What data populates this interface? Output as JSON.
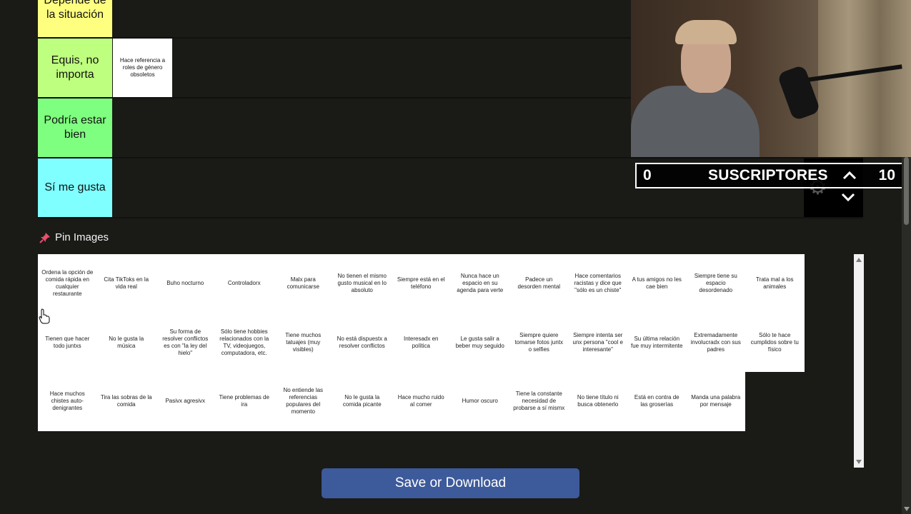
{
  "tiers": [
    {
      "label": "Depende de la situación",
      "color": "#ffff7f",
      "items": []
    },
    {
      "label": "Equis, no importa",
      "color": "#bfff7f",
      "items": [
        "Hace referencia a roles de género obsoletos"
      ]
    },
    {
      "label": "Podría estar bien",
      "color": "#7fff7f",
      "items": []
    },
    {
      "label": "Sí me gusta",
      "color": "#7fffff",
      "items": []
    }
  ],
  "overlay": {
    "current": "0",
    "label": "SUSCRIPTORES",
    "goal": "10"
  },
  "pin_section": {
    "title": "Pin Images",
    "icon": "pushpin-icon",
    "icon_color": "#e5506a"
  },
  "pins": [
    [
      "Ordena la opción de comida rápida en cualquier restaurante",
      "Cita TikToks en la vida real",
      "Buho nocturno",
      "Controladorx",
      "Malx para comunicarse",
      "No tienen el mismo gusto musical en lo absoluto",
      "Siempre está en el teléfono",
      "Nunca hace un espacio en su agenda para verte",
      "Padece un desorden mental",
      "Hace comentarios racistas y dice que \"sólo es un chiste\"",
      "A tus amigos no les cae bien",
      "Siempre tiene su espacio desordenado",
      "Trata mal a los animales"
    ],
    [
      "Tienen que hacer todo juntxs",
      "No le gusta la música",
      "Su forma de resolver conflictos es con \"la ley del hielo\"",
      "Sólo tiene hobbies relacionados con la TV, videojuegos, computadora, etc.",
      "Tiene muchos tatuajes (muy visibles)",
      "No está dispuestx a resolver conflictos",
      "Interesadx en política",
      "Le gusta salir a beber muy seguido",
      "Siempre quiere tomarse fotos juntx o selfies",
      "Siempre intenta ser unx persona \"cool e interesante\"",
      "Su última relación fue muy intermitente",
      "Extremadamente involucradx con sus padres",
      "Sólo te hace cumplidos sobre tu físico"
    ],
    [
      "Hace muchos chistes auto-denigrantes",
      "Tira las sobras de la comida",
      "Pasivx agresivx",
      "Tiene problemas de ira",
      "No entiende las referencias populares del momento",
      "No le gusta la comida picante",
      "Hace mucho ruido al comer",
      "Humor oscuro",
      "Tiene la constante necesidad de probarse a sí mismx",
      "No tiene título ni busca obtenerlo",
      "Está en contra de las groserías",
      "Manda una palabra por mensaje"
    ]
  ],
  "save_button": "Save or Download",
  "colors": {
    "background": "#1a1a17",
    "button": "#3d5a9a"
  }
}
